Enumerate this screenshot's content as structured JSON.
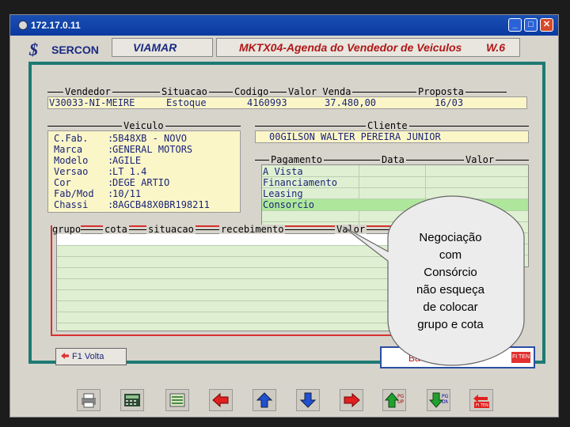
{
  "window": {
    "title": "172.17.0.11"
  },
  "header": {
    "logo_symbol": "$",
    "logo_text": "SERCON",
    "company": "VIAMAR",
    "title": "MKTX04-Agenda do Vendedor de Veiculos",
    "version": "W.6"
  },
  "top": {
    "labels": {
      "vendedor": "Vendedor",
      "situacao": "Situacao",
      "codigo": "Codigo",
      "valor_venda": "Valor Venda",
      "proposta": "Proposta"
    },
    "values": {
      "vendedor": "V30033-NI-MEIRE",
      "situacao": "Estoque",
      "codigo": "4160993",
      "valor_venda": "37.480,00",
      "proposta": "16/03"
    }
  },
  "veiculo": {
    "label": "Veiculo",
    "rows": [
      {
        "label": "C.Fab.",
        "value": "5B48XB - NOVO"
      },
      {
        "label": "Marca",
        "value": "GENERAL MOTORS"
      },
      {
        "label": "Modelo",
        "value": "AGILE"
      },
      {
        "label": "Versao",
        "value": "LT 1.4"
      },
      {
        "label": "Cor",
        "value": "DEGE ARTIO"
      },
      {
        "label": "Fab/Mod",
        "value": "10/11"
      },
      {
        "label": "Chassi",
        "value": "8AGCB48X0BR198211"
      }
    ]
  },
  "cliente": {
    "label": "Cliente",
    "value": "00GILSON WALTER PEREIRA JUNIOR"
  },
  "pagamento": {
    "labels": {
      "pagamento": "Pagamento",
      "data": "Data",
      "valor": "Valor"
    },
    "rows": [
      "A Vista",
      "Financiamento",
      "Leasing",
      "Consorcio"
    ]
  },
  "consorcio": {
    "columns": [
      "grupo",
      "cota",
      "situacao",
      "recebimento",
      "Valor"
    ]
  },
  "buttons": {
    "f1": "F1 Volta",
    "ok": "Ba",
    "fimenu": "FI TEN"
  },
  "balloon": {
    "text": [
      "Negociação",
      "com",
      "Consórcio",
      "não esqueça",
      "de colocar",
      "grupo e cota"
    ]
  },
  "toolbar": {
    "items": [
      "printer",
      "calculator",
      "list",
      "left",
      "up",
      "down",
      "right",
      "page-up",
      "page-down",
      "exit"
    ]
  },
  "colors": {
    "teal_border": "#1e7a73",
    "red_highlight": "#d93030",
    "yellow_field": "#fbf6c8",
    "green_grid": "#dff0d2"
  }
}
